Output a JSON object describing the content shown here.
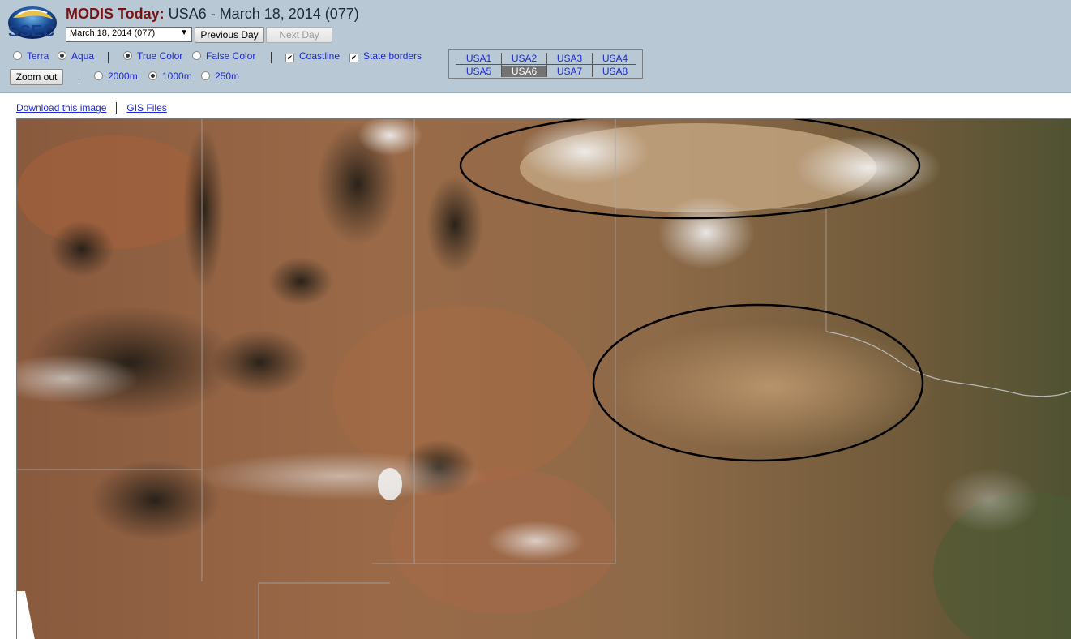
{
  "header": {
    "logo_text": "SSEC",
    "title_brand": "MODIS Today:",
    "title_rest": " USA6 - March 18, 2014 (077)"
  },
  "controls": {
    "date_value": "March 18, 2014 (077)",
    "prev_label": "Previous Day",
    "next_label": "Next Day",
    "zoom_label": "Zoom out",
    "satellite": [
      {
        "label": "Terra",
        "selected": false
      },
      {
        "label": "Aqua",
        "selected": true
      }
    ],
    "color": [
      {
        "label": "True Color",
        "selected": true
      },
      {
        "label": "False Color",
        "selected": false
      }
    ],
    "overlays": [
      {
        "label": "Coastline",
        "checked": true
      },
      {
        "label": "State borders",
        "checked": true
      }
    ],
    "resolution": [
      {
        "label": "2000m",
        "selected": false
      },
      {
        "label": "1000m",
        "selected": true
      },
      {
        "label": "250m",
        "selected": false
      }
    ]
  },
  "regions": [
    {
      "label": "USA1",
      "active": false
    },
    {
      "label": "USA2",
      "active": false
    },
    {
      "label": "USA3",
      "active": false
    },
    {
      "label": "USA4",
      "active": false
    },
    {
      "label": "USA5",
      "active": false
    },
    {
      "label": "USA6",
      "active": true
    },
    {
      "label": "USA7",
      "active": false
    },
    {
      "label": "USA8",
      "active": false
    }
  ],
  "links": {
    "download": "Download this image",
    "gis": "GIS Files"
  },
  "colors": {
    "header_bg": "#b8c8d4",
    "brand": "#7a1212",
    "link": "#1e2ad0"
  }
}
